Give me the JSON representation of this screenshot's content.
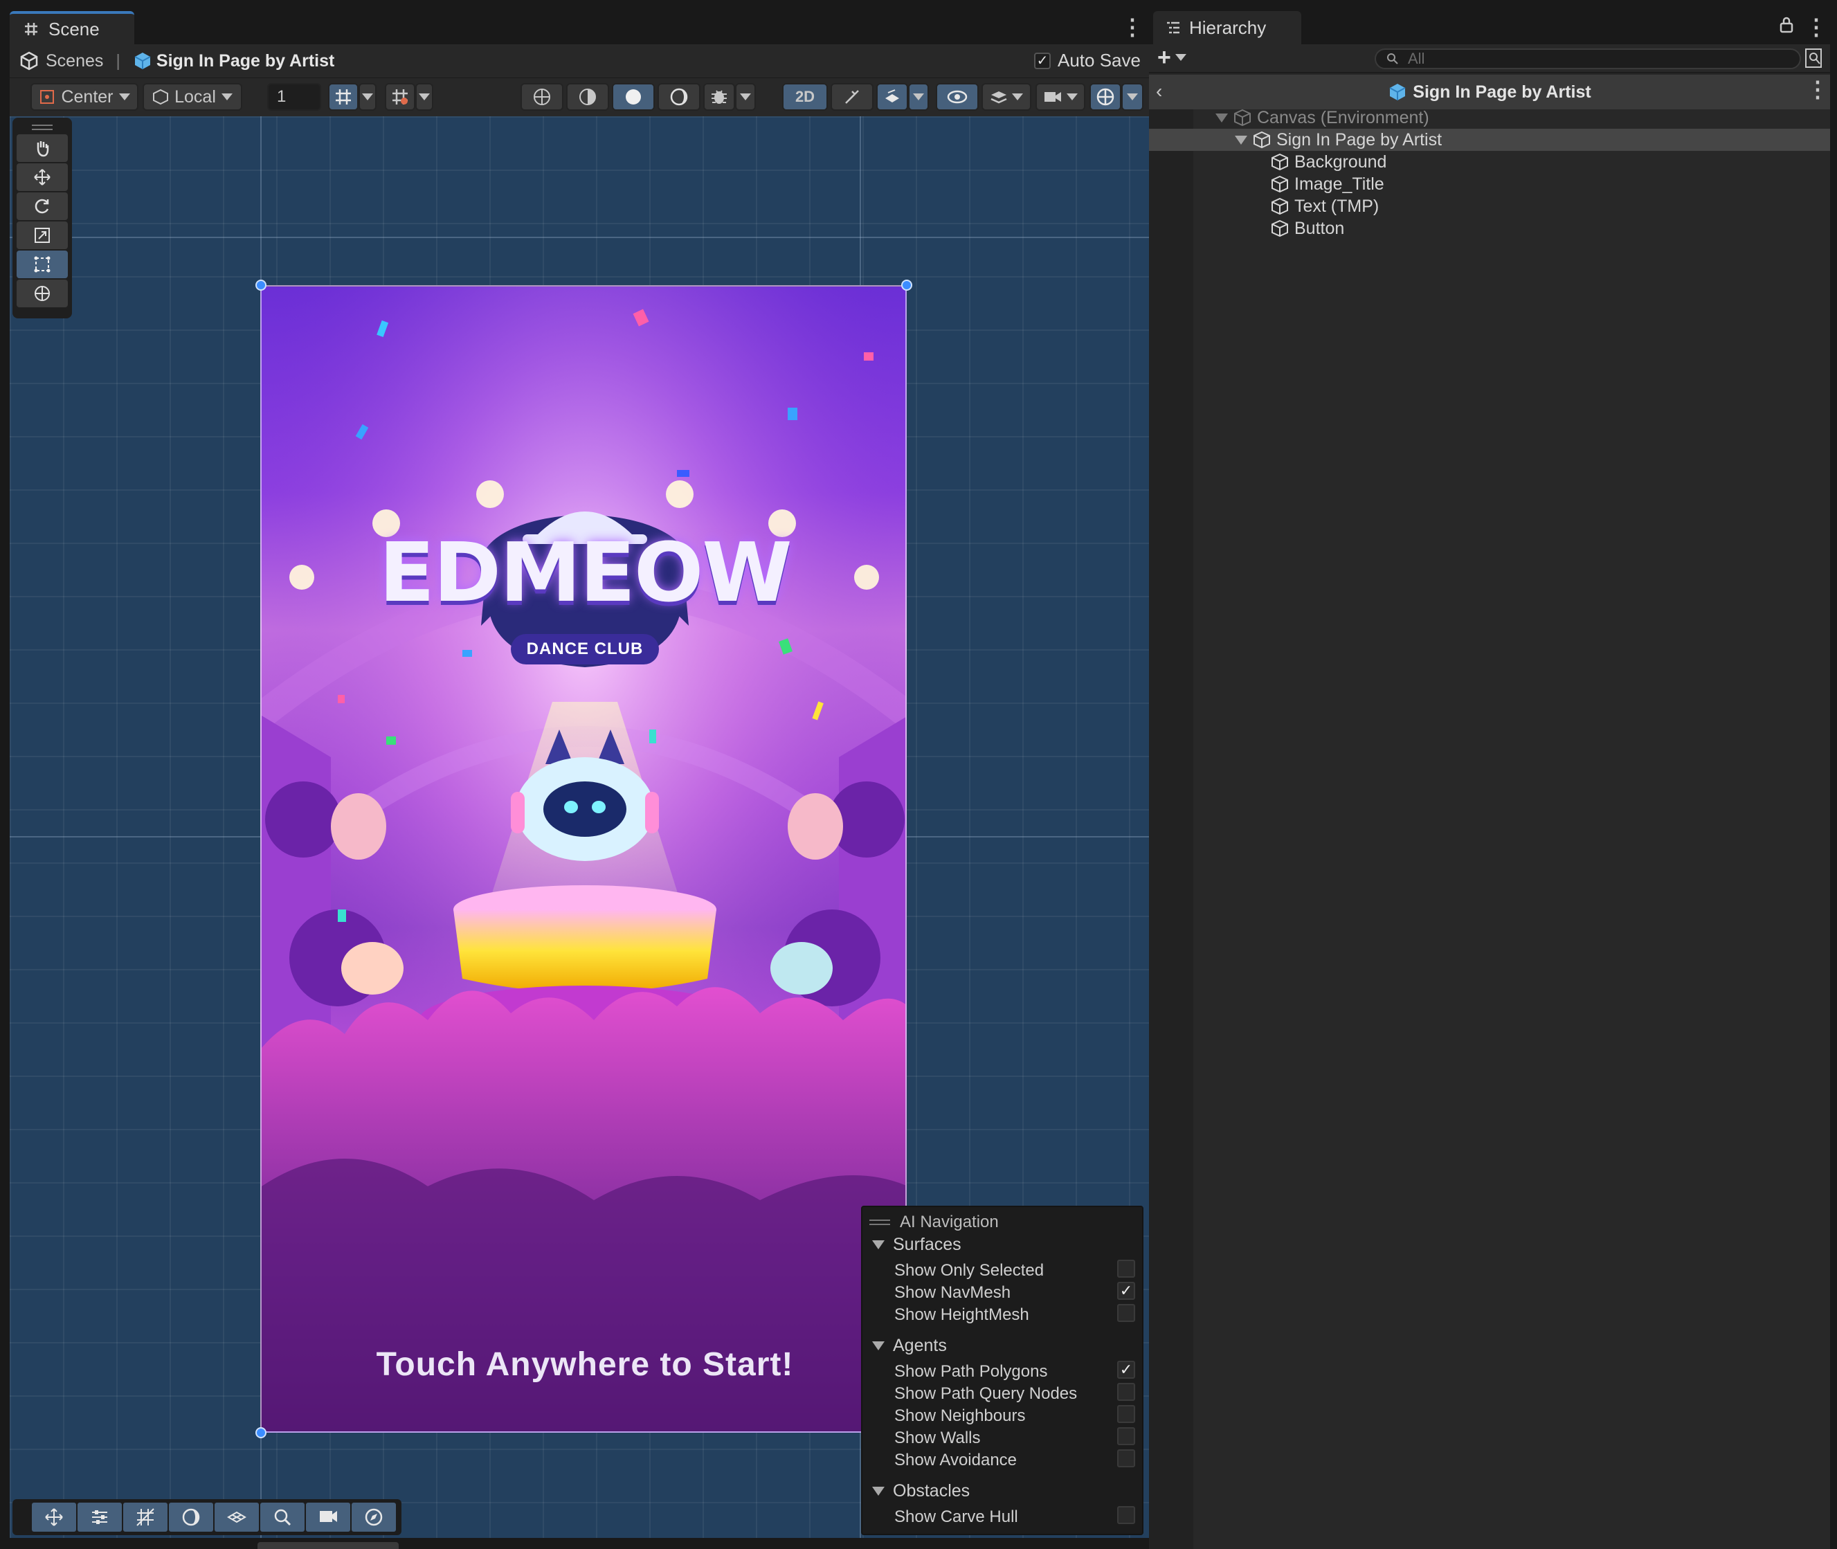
{
  "scene_panel": {
    "tab_label": "Scene",
    "breadcrumb": {
      "root": "Scenes",
      "current": "Sign In Page by Artist"
    },
    "auto_save_label": "Auto Save",
    "auto_save_checked": true,
    "toolbar": {
      "pivot_mode": "Center",
      "pivot_rotation": "Local",
      "grid_size_value": "1",
      "mode_2d_label": "2D"
    }
  },
  "canvas": {
    "title_main": "EDMEOW",
    "title_sub": "DANCE CLUB",
    "prompt_text": "Touch Anywhere to Start!"
  },
  "ai_navigation": {
    "title": "AI Navigation",
    "sections": [
      {
        "name": "Surfaces",
        "items": [
          {
            "label": "Show Only Selected",
            "checked": false
          },
          {
            "label": "Show NavMesh",
            "checked": true
          },
          {
            "label": "Show HeightMesh",
            "checked": false
          }
        ]
      },
      {
        "name": "Agents",
        "items": [
          {
            "label": "Show Path Polygons",
            "checked": true
          },
          {
            "label": "Show Path Query Nodes",
            "checked": false
          },
          {
            "label": "Show Neighbours",
            "checked": false
          },
          {
            "label": "Show Walls",
            "checked": false
          },
          {
            "label": "Show Avoidance",
            "checked": false
          }
        ]
      },
      {
        "name": "Obstacles",
        "items": [
          {
            "label": "Show Carve Hull",
            "checked": false
          }
        ]
      }
    ]
  },
  "hierarchy": {
    "tab_label": "Hierarchy",
    "search_placeholder": "All",
    "header_title": "Sign In Page by Artist",
    "tree": [
      {
        "label": "Canvas (Environment)",
        "depth": 0,
        "expanded": true,
        "dimmed": true
      },
      {
        "label": "Sign In Page by Artist",
        "depth": 1,
        "expanded": true,
        "selected": true
      },
      {
        "label": "Background",
        "depth": 2
      },
      {
        "label": "Image_Title",
        "depth": 2
      },
      {
        "label": "Text (TMP)",
        "depth": 2
      },
      {
        "label": "Button",
        "depth": 2
      }
    ]
  },
  "colors": {
    "accent_blue": "#3a79bb",
    "active_tool": "#46607c",
    "scene_bg": "#23405e",
    "panel_bg": "#282828"
  }
}
